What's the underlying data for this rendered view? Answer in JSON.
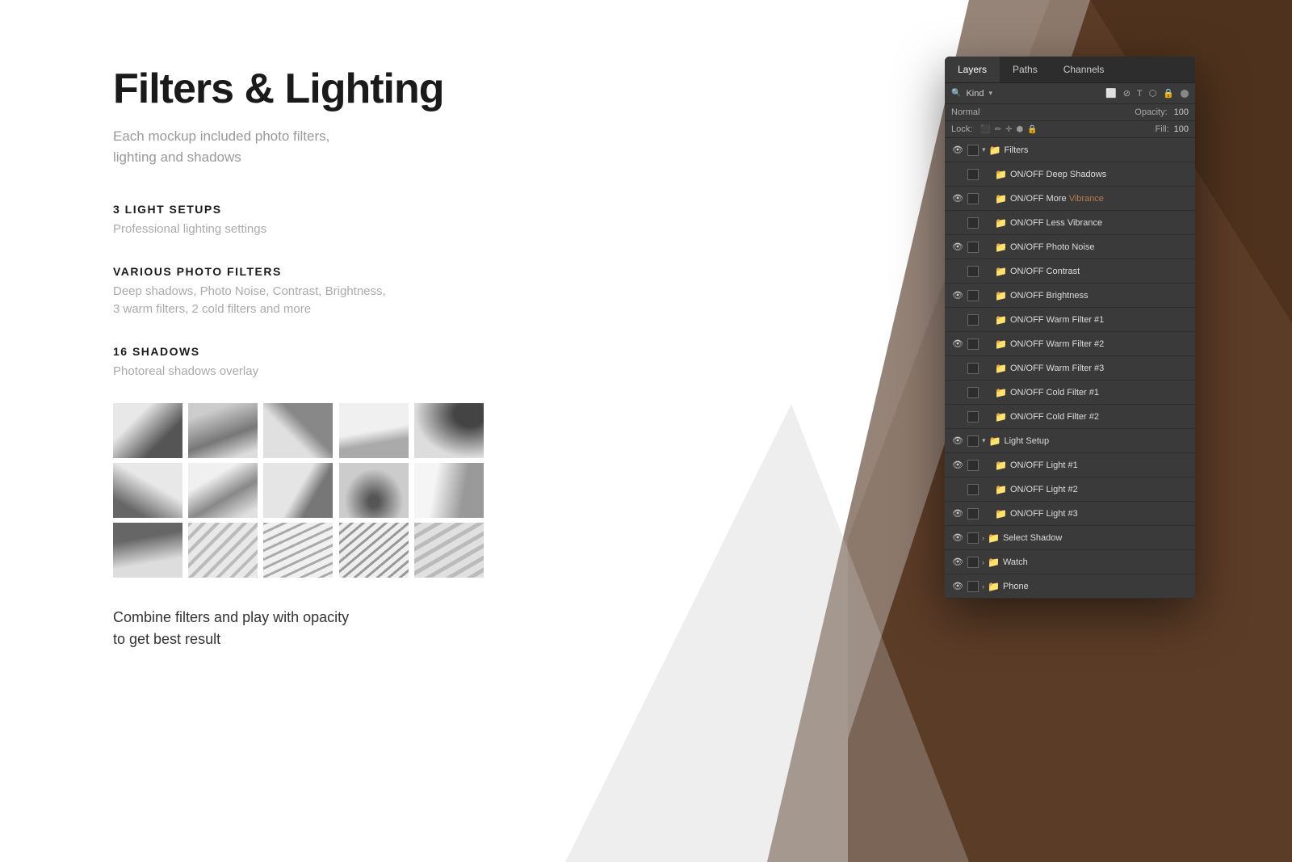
{
  "page": {
    "background_color": "#ffffff"
  },
  "content": {
    "title": "Filters & Lighting",
    "subtitle_line1": "Each mockup included photo filters,",
    "subtitle_line2": "lighting and shadows",
    "sections": [
      {
        "heading": "3 LIGHT SETUPS",
        "description": "Professional lighting settings"
      },
      {
        "heading": "VARIOUS PHOTO FILTERS",
        "description_line1": "Deep shadows, Photo Noise, Contrast, Brightness,",
        "description_line2": "3 warm filters, 2 cold filters and more"
      },
      {
        "heading": "16 SHADOWS",
        "description": "Photoreal shadows overlay"
      }
    ],
    "combine_text_line1": "Combine filters and play with opacity",
    "combine_text_line2": "to get best result"
  },
  "ps_panel": {
    "tabs": [
      "Layers",
      "Paths",
      "Channels"
    ],
    "active_tab": "Layers",
    "kind_label": "Kind",
    "blend_mode": "Normal",
    "opacity_label": "Opacity:",
    "opacity_value": "100",
    "lock_label": "Lock:",
    "fill_label": "Fill:",
    "fill_value": "100",
    "layers": [
      {
        "id": "filters-group",
        "name": "Filters",
        "type": "group",
        "visible": true,
        "expanded": true,
        "indent": 0
      },
      {
        "id": "deep-shadows",
        "name": "ON/OFF Deep Shadows",
        "type": "layer",
        "visible": false,
        "indent": 1
      },
      {
        "id": "more-vibrance",
        "name": "ON/OFF More Vibrance",
        "type": "layer",
        "visible": true,
        "indent": 1,
        "has_color": true
      },
      {
        "id": "less-vibrance",
        "name": "ON/OFF Less Vibrance",
        "type": "layer",
        "visible": false,
        "indent": 1
      },
      {
        "id": "photo-noise",
        "name": "ON/OFF Photo Noise",
        "type": "layer",
        "visible": true,
        "indent": 1
      },
      {
        "id": "contrast",
        "name": "ON/OFF Contrast",
        "type": "layer",
        "visible": false,
        "indent": 1
      },
      {
        "id": "brightness",
        "name": "ON/OFF Brightness",
        "type": "layer",
        "visible": true,
        "indent": 1
      },
      {
        "id": "warm-filter-1",
        "name": "ON/OFF Warm Filter #1",
        "type": "layer",
        "visible": false,
        "indent": 1
      },
      {
        "id": "warm-filter-2",
        "name": "ON/OFF Warm Filter #2",
        "type": "layer",
        "visible": true,
        "indent": 1
      },
      {
        "id": "warm-filter-3",
        "name": "ON/OFF Warm Filter #3",
        "type": "layer",
        "visible": false,
        "indent": 1
      },
      {
        "id": "cold-filter-1",
        "name": "ON/OFF Cold Filter #1",
        "type": "layer",
        "visible": false,
        "indent": 1
      },
      {
        "id": "cold-filter-2",
        "name": "ON/OFF Cold Filter #2",
        "type": "layer",
        "visible": false,
        "indent": 1
      },
      {
        "id": "light-setup",
        "name": "Light Setup",
        "type": "group",
        "visible": true,
        "expanded": true,
        "indent": 0
      },
      {
        "id": "light-1",
        "name": "ON/OFF Light #1",
        "type": "layer",
        "visible": true,
        "indent": 1
      },
      {
        "id": "light-2",
        "name": "ON/OFF Light #2",
        "type": "layer",
        "visible": false,
        "indent": 1
      },
      {
        "id": "light-3",
        "name": "ON/OFF Light #3",
        "type": "layer",
        "visible": true,
        "indent": 1
      },
      {
        "id": "select-shadow",
        "name": "Select Shadow",
        "type": "group",
        "visible": true,
        "expanded": false,
        "indent": 0
      },
      {
        "id": "watch",
        "name": "Watch",
        "type": "group",
        "visible": true,
        "expanded": false,
        "indent": 0
      },
      {
        "id": "phone",
        "name": "Phone",
        "type": "group",
        "visible": true,
        "expanded": false,
        "indent": 0
      }
    ]
  }
}
